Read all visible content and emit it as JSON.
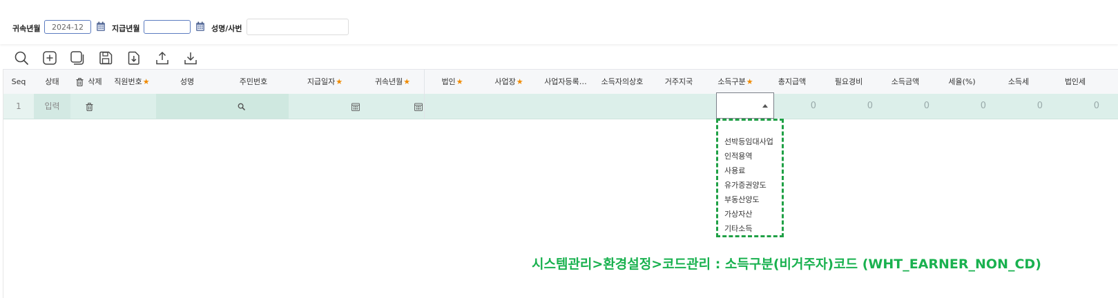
{
  "filters": {
    "belong_month_label": "귀속년월",
    "belong_month_value": "2024-12",
    "pay_month_label": "지급년월",
    "pay_month_value": "",
    "name_label": "성명/사번",
    "name_value": ""
  },
  "toolbar": [
    "search-icon",
    "add-icon",
    "copy-icon",
    "save-icon",
    "import-icon",
    "upload-icon",
    "download-icon"
  ],
  "grid": {
    "headers": {
      "seq": "Seq",
      "status": "상태",
      "delete": "삭제",
      "emp_no": "직원번호",
      "name": "성명",
      "resident_no": "주민번호",
      "pay_date": "지급일자",
      "belong_month": "귀속년월",
      "corp": "법인",
      "workplace": "사업장",
      "biz_reg": "사업자등록…",
      "earner_biz": "소득자의상호",
      "residence": "거주지국",
      "income_type": "소득구분",
      "total_pay": "총지급액",
      "expense": "필요경비",
      "income_amt": "소득금액",
      "tax_rate": "세율(%)",
      "income_tax": "소득세",
      "corp_tax": "법인세"
    },
    "row": {
      "seq": "1",
      "status": "입력",
      "total_pay": "0",
      "expense": "0",
      "income_amt": "0",
      "tax_rate": "0",
      "income_tax": "0",
      "corp_tax": "0"
    }
  },
  "income_type_options": [
    "선박등임대사업",
    "인적용역",
    "사용료",
    "유가증권양도",
    "부동산양도",
    "가상자산",
    "기타소득"
  ],
  "caption": "시스템관리>환경설정>코드관리 : 소득구분(비거주자)코드 (WHT_EARNER_NON_CD)",
  "colors": {
    "accent": "#5b7bc0",
    "row_bg": "#dcefea",
    "required": "#f08a00",
    "caption": "#19b14f"
  }
}
